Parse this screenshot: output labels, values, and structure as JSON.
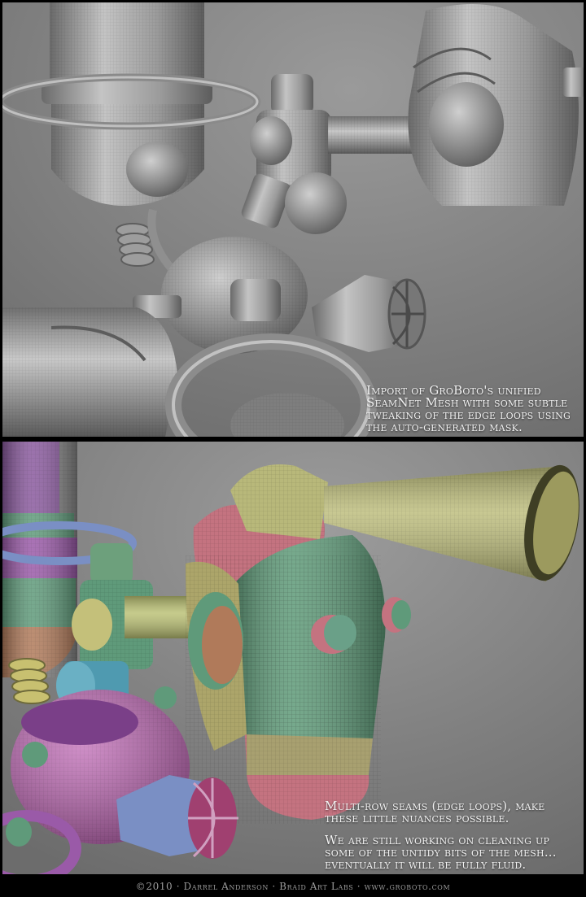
{
  "top_panel": {
    "caption_lines": [
      "Import of GroBoto's unified",
      "SeamNet Mesh with some subtle",
      "tweaking of the edge loops using",
      "the auto-generated mask."
    ]
  },
  "bottom_panel": {
    "caption_paragraph_1": [
      "Multi-row seams (edge loops), make",
      "these little nuances possible."
    ],
    "caption_paragraph_2": [
      "We are still working on cleaning up",
      "some of the untidy bits of the mesh...",
      "eventually it will be fully fluid."
    ]
  },
  "credit": "©2010 · Darrel Anderson · Braid Art Labs · www.groboto.com",
  "colors": {
    "background_gray": "#8c8c8c",
    "clay_gray": "#a9a9a9",
    "seam_purple": "#9a5aa8",
    "seam_green": "#5f9a7a",
    "seam_pink": "#c47380",
    "seam_yellow": "#b8b87a",
    "seam_blue": "#7a8fc4"
  }
}
